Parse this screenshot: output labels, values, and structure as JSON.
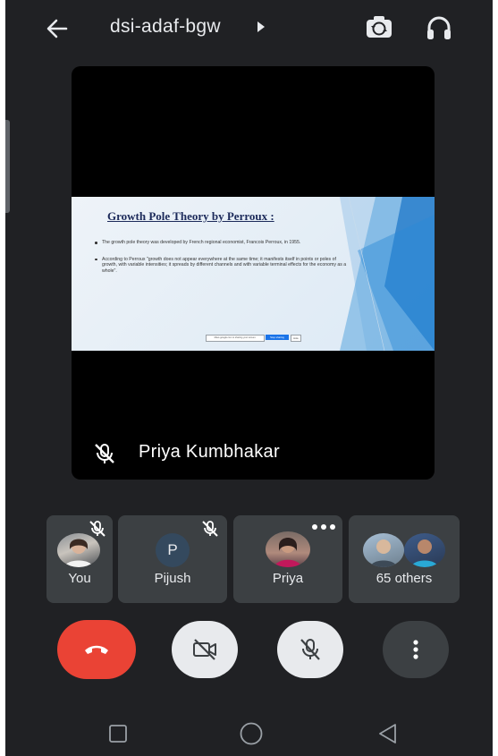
{
  "meeting": {
    "code": "dsi-adaf-bgw"
  },
  "main_tile": {
    "speaker_name": "Priya Kumbhakar",
    "slide": {
      "title": "Growth Pole Theory by Perroux :",
      "bullets": [
        "The growth pole theory was developed by French regional economist, Francois Perroux, in 1955.",
        "According to Perroux \"growth does not appear everywhere at the same time; it manifests itself in points or poles of growth, with variable intensities; it spreads by different channels and with variable terminal effects for the economy as a whole\"."
      ],
      "share_bar_text": "Meet.google.com is sharing your screen.",
      "share_bar_button": "Stop sharing",
      "share_bar_hide": "Hide"
    }
  },
  "participants": [
    {
      "label": "You",
      "muted": true
    },
    {
      "label": "Pijush",
      "initial": "P",
      "muted": true
    },
    {
      "label": "Priya",
      "muted": false
    },
    {
      "label": "65 others"
    }
  ],
  "colors": {
    "background": "#202124",
    "tile": "#3c4043",
    "end_call": "#ea4335",
    "control_light": "#e8eaed",
    "control_dark": "#3c4043"
  },
  "icons": {
    "back": "arrow-left-icon",
    "switch_camera": "switch-camera-icon",
    "audio_output": "headphones-icon",
    "end_call": "phone-hangup-icon",
    "camera_off": "video-off-icon",
    "mic_off": "mic-off-icon",
    "more": "more-vertical-icon"
  }
}
